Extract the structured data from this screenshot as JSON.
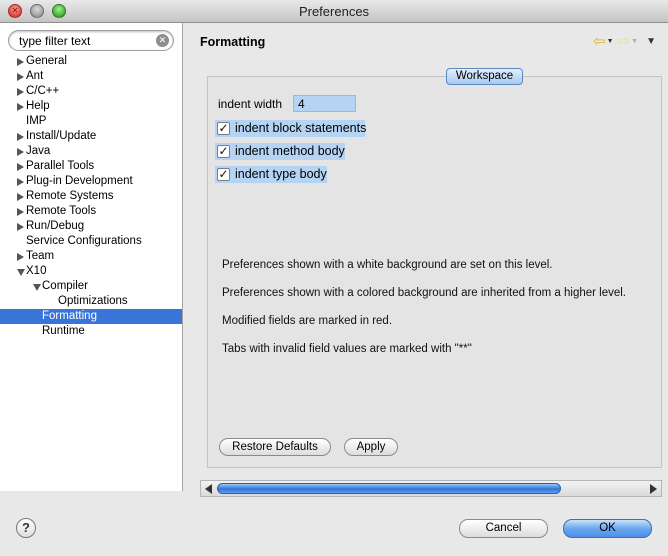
{
  "window": {
    "title": "Preferences"
  },
  "search": {
    "placeholder": "type filter text",
    "value": "type filter text"
  },
  "tree": [
    {
      "label": "General",
      "level": 0,
      "expander": "collapsed"
    },
    {
      "label": "Ant",
      "level": 0,
      "expander": "collapsed"
    },
    {
      "label": "C/C++",
      "level": 0,
      "expander": "collapsed"
    },
    {
      "label": "Help",
      "level": 0,
      "expander": "collapsed"
    },
    {
      "label": "IMP",
      "level": 0,
      "expander": "none"
    },
    {
      "label": "Install/Update",
      "level": 0,
      "expander": "collapsed"
    },
    {
      "label": "Java",
      "level": 0,
      "expander": "collapsed"
    },
    {
      "label": "Parallel Tools",
      "level": 0,
      "expander": "collapsed"
    },
    {
      "label": "Plug-in Development",
      "level": 0,
      "expander": "collapsed"
    },
    {
      "label": "Remote Systems",
      "level": 0,
      "expander": "collapsed"
    },
    {
      "label": "Remote Tools",
      "level": 0,
      "expander": "collapsed"
    },
    {
      "label": "Run/Debug",
      "level": 0,
      "expander": "collapsed"
    },
    {
      "label": "Service Configurations",
      "level": 0,
      "expander": "none"
    },
    {
      "label": "Team",
      "level": 0,
      "expander": "collapsed"
    },
    {
      "label": "X10",
      "level": 0,
      "expander": "expanded"
    },
    {
      "label": "Compiler",
      "level": 1,
      "expander": "expanded"
    },
    {
      "label": "Optimizations",
      "level": 2,
      "expander": "none"
    },
    {
      "label": "Formatting",
      "level": 1,
      "expander": "none",
      "selected": true
    },
    {
      "label": "Runtime",
      "level": 1,
      "expander": "none"
    }
  ],
  "header": {
    "title": "Formatting",
    "icons": {
      "back": "back-arrow-icon",
      "forward": "forward-arrow-icon",
      "menu": "view-menu-icon"
    }
  },
  "content": {
    "tab_label": "Workspace",
    "indent_width_label": "indent width",
    "indent_width_value": "4",
    "checkboxes": [
      {
        "label": "indent block statements",
        "checked": true
      },
      {
        "label": "indent method body",
        "checked": true
      },
      {
        "label": "indent type body",
        "checked": true
      }
    ],
    "info": [
      "Preferences shown with a white background are set on this level.",
      "Preferences shown with a colored background are inherited from a higher level.",
      "Modified fields are marked in red.",
      "Tabs with invalid field values are marked with \"**\""
    ],
    "restore_defaults_label": "Restore Defaults",
    "apply_label": "Apply"
  },
  "footer": {
    "cancel_label": "Cancel",
    "ok_label": "OK",
    "help_icon": "help-icon"
  },
  "colors": {
    "selection": "#3875d7",
    "inherited_bg": "#b5d4f4",
    "ok_button": "#4d8fe6"
  }
}
